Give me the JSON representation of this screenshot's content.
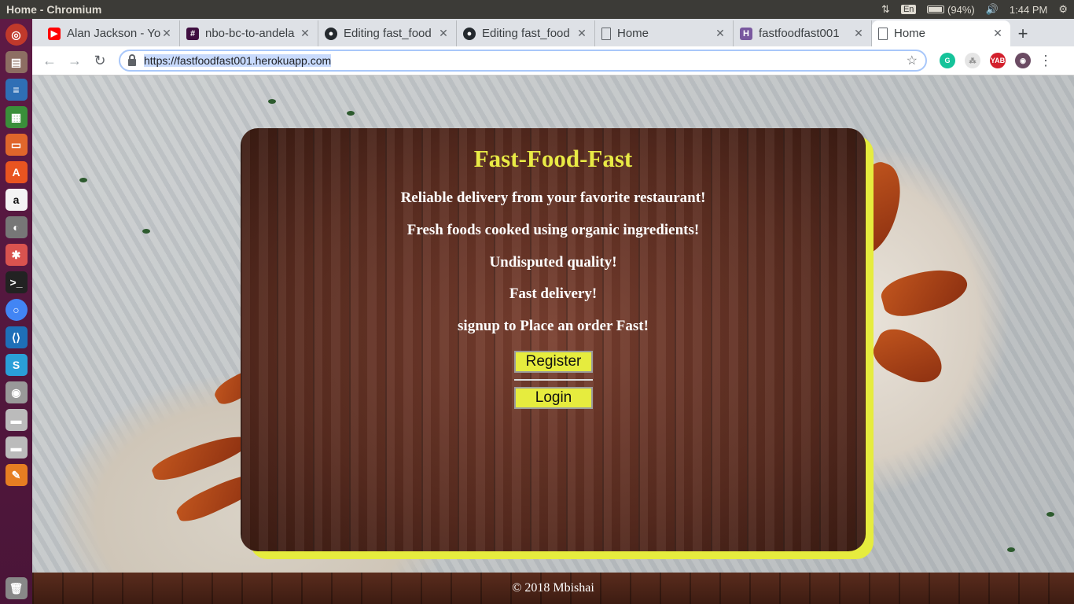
{
  "window": {
    "title": "Home - Chromium"
  },
  "tray": {
    "lang": "En",
    "battery": "(94%)",
    "time": "1:44 PM"
  },
  "tabs": [
    {
      "label": "Alan Jackson - Yo",
      "icon": "youtube-icon",
      "color": "#ff0000"
    },
    {
      "label": "nbo-bc-to-andela",
      "icon": "slack-hash-icon",
      "color": "#3f0e40"
    },
    {
      "label": "Editing fast_food",
      "icon": "github-icon",
      "color": "#24292e"
    },
    {
      "label": "Editing fast_food",
      "icon": "github-icon",
      "color": "#24292e"
    },
    {
      "label": "Home",
      "icon": "page-icon",
      "color": "#5f6368"
    },
    {
      "label": "fastfoodfast001",
      "icon": "heroku-icon",
      "color": "#79589f"
    },
    {
      "label": "Home",
      "icon": "page-icon",
      "color": "#5f6368"
    }
  ],
  "address": {
    "url": "https://fastfoodfast001.herokuapp.com"
  },
  "page": {
    "title": "Fast-Food-Fast",
    "lines": [
      "Reliable delivery from your favorite restaurant!",
      "Fresh foods cooked using organic ingredients!",
      "Undisputed quality!",
      "Fast delivery!",
      "signup to Place an order Fast!"
    ],
    "register_label": "Register",
    "login_label": "Login",
    "footer": "© 2018 Mbishai"
  },
  "colors": {
    "accent": "#e6ec3e",
    "title": "#e8ea45",
    "launcher": "#5e1a45"
  }
}
